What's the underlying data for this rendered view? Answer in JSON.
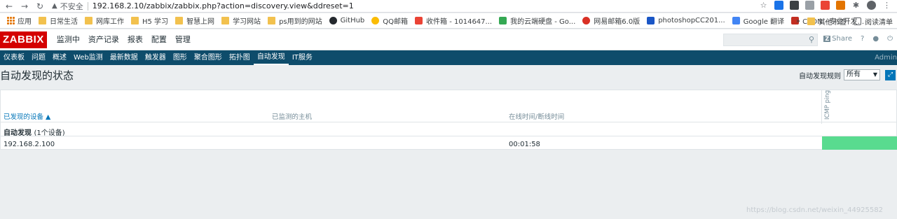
{
  "browser": {
    "insecure_label": "不安全",
    "url": "192.168.2.10/zabbix/zabbix.php?action=discovery.view&ddreset=1",
    "bookmarks": [
      "应用",
      "日常生活",
      "网库工作",
      "H5 学习",
      "智慧上网",
      "学习网站",
      "ps用到的网站",
      "GitHub",
      "QQ邮箱",
      "收件箱 - 1014647...",
      "我的云端硬盘 - Go...",
      "网易邮箱6.0版",
      "photoshopCC201...",
      "Google 翻译",
      "CSDN - 专业开发..."
    ],
    "bookmark_more": "»",
    "other_bookmarks": "其他书签",
    "reading_list": "阅读清单"
  },
  "header": {
    "logo": "ZABBIX",
    "menu": [
      "监测中",
      "资产记录",
      "报表",
      "配置",
      "管理"
    ],
    "share": "Share",
    "share_badge": "Z",
    "help": "?"
  },
  "subnav": {
    "items": [
      "仪表板",
      "问题",
      "概述",
      "Web监测",
      "最新数据",
      "触发器",
      "图形",
      "聚合图形",
      "拓扑图",
      "自动发现",
      "IT服务"
    ],
    "active": "自动发现",
    "user": "Admin"
  },
  "page": {
    "title": "自动发现的状态",
    "filter_label": "自动发现规则",
    "filter_value": "所有"
  },
  "table": {
    "col_device": "已发现的设备 ▲",
    "col_host": "已监测的主机",
    "col_uptime": "在线时间/断线时间",
    "col_icmp": "ICMP ping",
    "group": {
      "name": "自动发现",
      "count": "(1个设备)"
    },
    "rows": [
      {
        "device": "192.168.2.100",
        "host": "",
        "uptime": "00:01:58"
      }
    ]
  },
  "colors": {
    "status_up": "#59db8f",
    "subnav_bg": "#0e4c6b",
    "logo_red": "#d40000"
  },
  "watermark": "https://blog.csdn.net/weixin_44925582"
}
